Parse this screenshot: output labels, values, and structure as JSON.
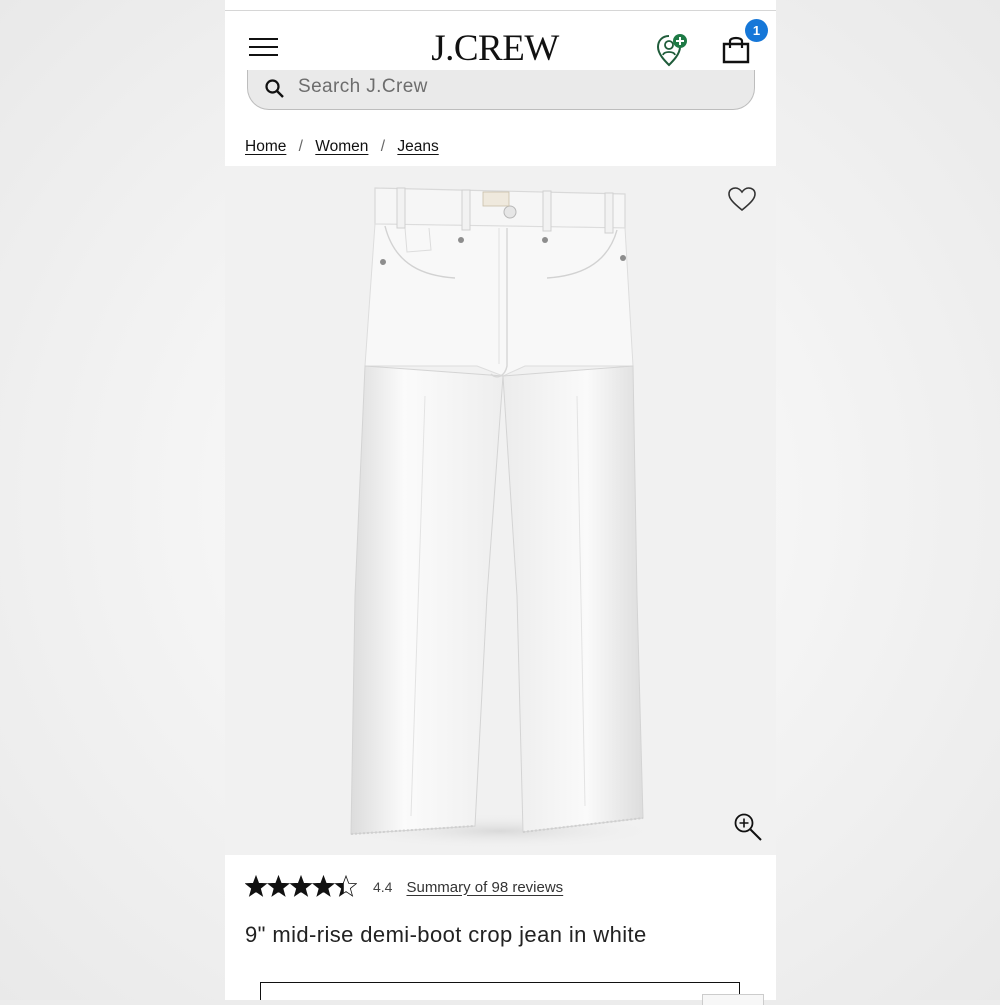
{
  "header": {
    "logo": "J.CREW",
    "bag_count": "1"
  },
  "search": {
    "placeholder": "Search J.Crew"
  },
  "breadcrumb": {
    "items": [
      {
        "label": "Home"
      },
      {
        "label": "Women"
      },
      {
        "label": "Jeans"
      }
    ],
    "separator": "/"
  },
  "product": {
    "rating": {
      "value": "4.4",
      "stars_fraction": 0.88,
      "reviews_link": "Summary of 98 reviews"
    },
    "title": "9\" mid-rise demi-boot crop jean in white"
  },
  "icons": {
    "menu": "hamburger-menu-icon",
    "account": "account-icon",
    "bag": "shopping-bag-icon",
    "search": "search-icon",
    "wishlist": "heart-icon",
    "zoom": "zoom-in-icon"
  },
  "colors": {
    "badge": "#1677d8",
    "account_badge": "#1e7a45"
  }
}
